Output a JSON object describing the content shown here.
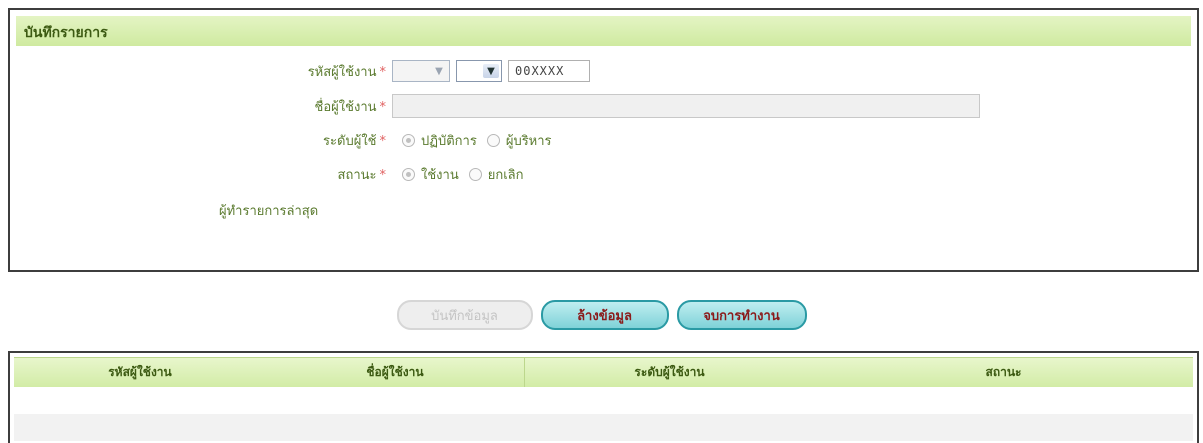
{
  "form": {
    "title": "บันทึกรายการ",
    "fields": {
      "user_code": {
        "label": "รหัสผู้ใช้งาน",
        "required_mark": "*",
        "code_value": "00XXXX"
      },
      "user_name": {
        "label": "ชื่อผู้ใช้งาน",
        "required_mark": "*",
        "value": ""
      },
      "user_level": {
        "label": "ระดับผู้ใช้",
        "required_mark": "*",
        "options": [
          "ปฏิบัติการ",
          "ผู้บริหาร"
        ],
        "selected": "ปฏิบัติการ"
      },
      "status": {
        "label": "สถานะ",
        "required_mark": "*",
        "options": [
          "ใช้งาน",
          "ยกเลิก"
        ],
        "selected": "ใช้งาน"
      },
      "last_editor": {
        "label": "ผู้ทำรายการล่าสุด",
        "value": ""
      }
    }
  },
  "buttons": {
    "save": "บันทึกข้อมูล",
    "clear": "ล้างข้อมูล",
    "exit": "จบการทำงาน"
  },
  "table": {
    "columns": [
      "รหัสผู้ใช้งาน",
      "ชื่อผู้ใช้งาน",
      "ระดับผู้ใช้งาน",
      "สถานะ"
    ],
    "rows": []
  },
  "icons": {
    "dropdown": "chevron-down-icon"
  },
  "colors": {
    "header_green": "#d6eeaa",
    "label_green": "#5a7a2e",
    "required_red": "#e06060",
    "button_teal": "#7fd2d8",
    "button_text": "#8b1a1a"
  }
}
